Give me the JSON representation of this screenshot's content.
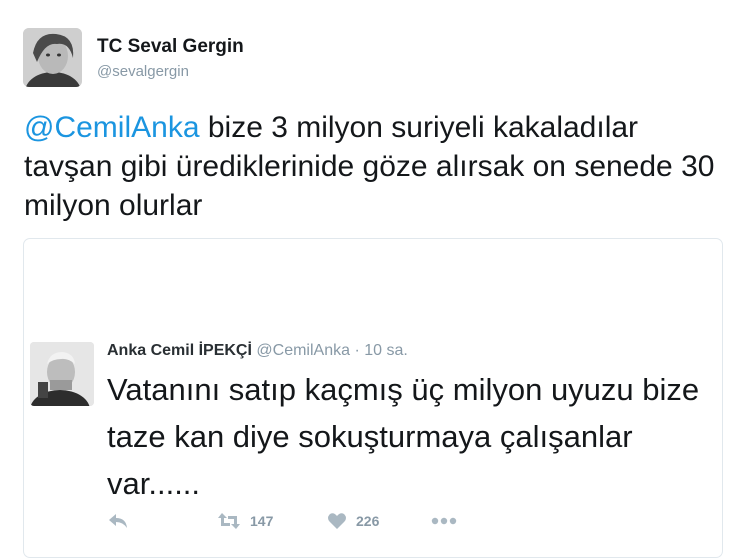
{
  "author": {
    "display_name": "TC Seval Gergin",
    "handle": "@sevalgergin"
  },
  "tweet": {
    "mention": "@CemilAnka",
    "text": " bize 3 milyon suriyeli  kakaladılar tavşan gibi üredikler­inide göze alırsak on senede 30 milyon olurlar"
  },
  "quoted": {
    "name": "Anka Cemil İPEKÇİ",
    "handle": "@CemilAnka",
    "separator": " · ",
    "time": "10 sa.",
    "text": "Vatanını satıp kaçmış üç milyon uyuzu bize taze kan diye sokuşturmaya çalışanlar var......",
    "retweets": "147",
    "likes": "226"
  },
  "icons": {
    "reply": "reply-icon",
    "retweet": "retweet-icon",
    "like": "heart-icon",
    "more": "more-icon"
  },
  "colors": {
    "link": "#1b95e0",
    "muted": "#8899a6",
    "icon": "#aab8c2",
    "border": "#e1e8ed"
  }
}
